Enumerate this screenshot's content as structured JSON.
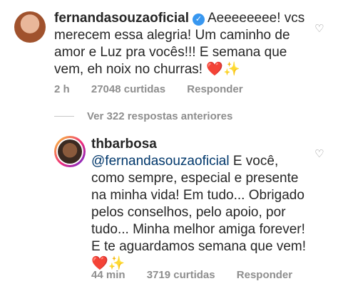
{
  "comment1": {
    "username": "fernandasouzaoficial",
    "text_lines": [
      "Aeeeeeeee! vcs",
      "merecem essa alegria! Um caminho de",
      "amor e Luz pra vocês!!! E semana que",
      "vem, eh noix no churras! "
    ],
    "emoji_heart": "❤️",
    "emoji_sparkles": "✨",
    "time": "2 h",
    "likes": "27048 curtidas",
    "reply": "Responder"
  },
  "view_replies": "Ver 322 respostas anteriores",
  "comment2": {
    "username": "thbarbosa",
    "mention": "@fernandasouzaoficial",
    "text_first": " E você,",
    "text_lines": [
      "como sempre, especial e presente",
      "na minha vida! Em tudo... Obrigado",
      "pelos conselhos, pelo apoio, por",
      "tudo... Minha melhor amiga forever!",
      "E te aguardamos semana que vem!"
    ],
    "emoji_heart": "❤️",
    "emoji_sparkles": "✨",
    "time": "44 min",
    "likes": "3719 curtidas",
    "reply": "Responder"
  },
  "icons": {
    "like1": "heart-outline-icon",
    "like2": "heart-outline-icon",
    "verified": "verified-badge-icon"
  }
}
